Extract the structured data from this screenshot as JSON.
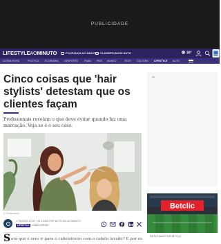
{
  "ad_top": {
    "label": "PUBLICIDADE"
  },
  "navbar": {
    "logo_main": "LIFESTYLE",
    "logo_ao": "AO",
    "logo_tail": "MINUTO",
    "link_poupanca": "POUPANÇA AO MINUTO",
    "link_classificados": "CLASSIFICADOS AUTO",
    "temperature": "30°",
    "colors": {
      "primary": "#2c2460",
      "secondary": "#3a327a",
      "accent": "#3a2c82"
    }
  },
  "subnav": {
    "items": [
      "ÚLTIMA HORA",
      "POLÍTICA",
      "ECONOMIA",
      "DESPORTO",
      "FAMA",
      "PAÍS",
      "MUNDO",
      "TECH",
      "CULTURA",
      "LIFESTYLE",
      "AUTO"
    ],
    "active": "LIFESTYLE"
  },
  "article": {
    "title": "Cinco coisas que 'hair stylists' detestam que os clientes façam",
    "subtitle": "Profissionais revelam o que deve evitar quando faz uma marcação. Veja se é o seu caso.",
    "photo_credit": "© Shutterstock",
    "date": "17/02/2025 12:15 ‧ HÁ 4 DIAS POR NOTÍCIAS AO MINUTO",
    "section_tag": "LIFESTYLE",
    "category": "CABELEIREIRO",
    "dropcap": "S",
    "body_first_line": "erá que é erro ir para o cabeleireiro com o cabelo lavado? E por escovar? Será"
  },
  "share_icons": [
    "whatsapp-icon",
    "email-icon",
    "facebook-icon",
    "linkedin-icon",
    "x-icon"
  ],
  "sidebar": {
    "ad_label": "AD",
    "betclic_brand": "Betclic",
    "betclic_caption": "PATROCINADO POR BETCLIC"
  }
}
